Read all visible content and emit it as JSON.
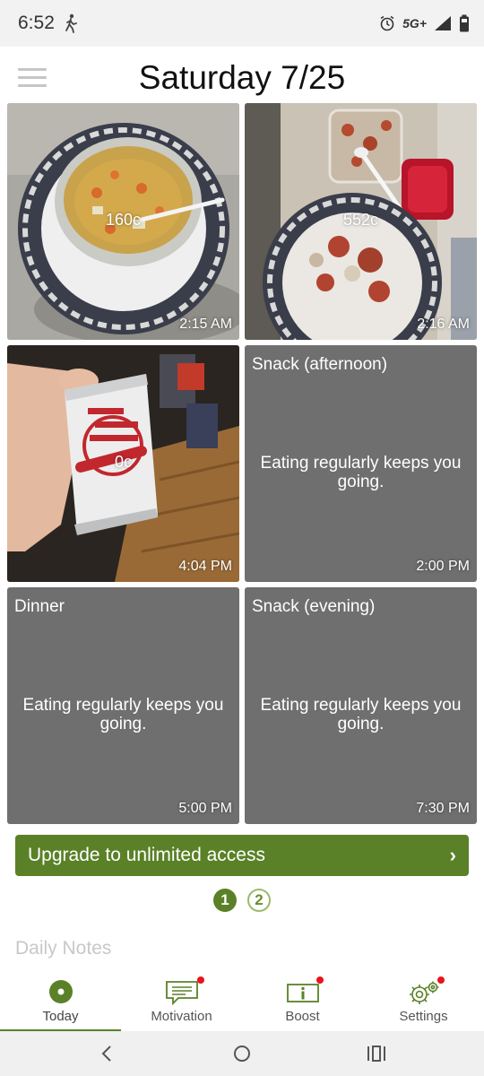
{
  "status_bar": {
    "time": "6:52",
    "network": "5G+",
    "walk_icon": "walking-person-icon",
    "alarm_icon": "alarm-icon",
    "signal_icon": "signal-icon",
    "battery_icon": "battery-icon"
  },
  "header": {
    "title": "Saturday 7/25",
    "menu_icon": "hamburger-menu-icon"
  },
  "meals": [
    {
      "type": "photo",
      "calories": "160c",
      "time": "2:15 AM",
      "photo": "bowl-of-soup"
    },
    {
      "type": "photo",
      "calories": "552c",
      "time": "2:16 AM",
      "photo": "plate-with-leftovers"
    },
    {
      "type": "photo",
      "calories": "0c",
      "time": "4:04 PM",
      "photo": "diet-dr-pepper-can"
    },
    {
      "type": "placeholder",
      "title": "Snack (afternoon)",
      "message": "Eating regularly keeps you going.",
      "time": "2:00 PM"
    },
    {
      "type": "placeholder",
      "title": "Dinner",
      "message": "Eating regularly keeps you going.",
      "time": "5:00 PM"
    },
    {
      "type": "placeholder",
      "title": "Snack (evening)",
      "message": "Eating regularly keeps you going.",
      "time": "7:30 PM"
    }
  ],
  "upgrade": {
    "label": "Upgrade to unlimited access",
    "chevron": "›"
  },
  "pager": {
    "pages": [
      "1",
      "2"
    ],
    "current": "1"
  },
  "daily_notes": {
    "label": "Daily Notes"
  },
  "bottom_nav": [
    {
      "label": "Today",
      "icon": "today-icon",
      "active": true,
      "badge": false
    },
    {
      "label": "Motivation",
      "icon": "motivation-message-icon",
      "active": false,
      "badge": true
    },
    {
      "label": "Boost",
      "icon": "boost-info-icon",
      "active": false,
      "badge": true
    },
    {
      "label": "Settings",
      "icon": "settings-gear-icon",
      "active": false,
      "badge": true
    }
  ],
  "colors": {
    "accent": "#5a8127",
    "tile_gray": "#6f6f6f",
    "notification": "#e8141c"
  }
}
